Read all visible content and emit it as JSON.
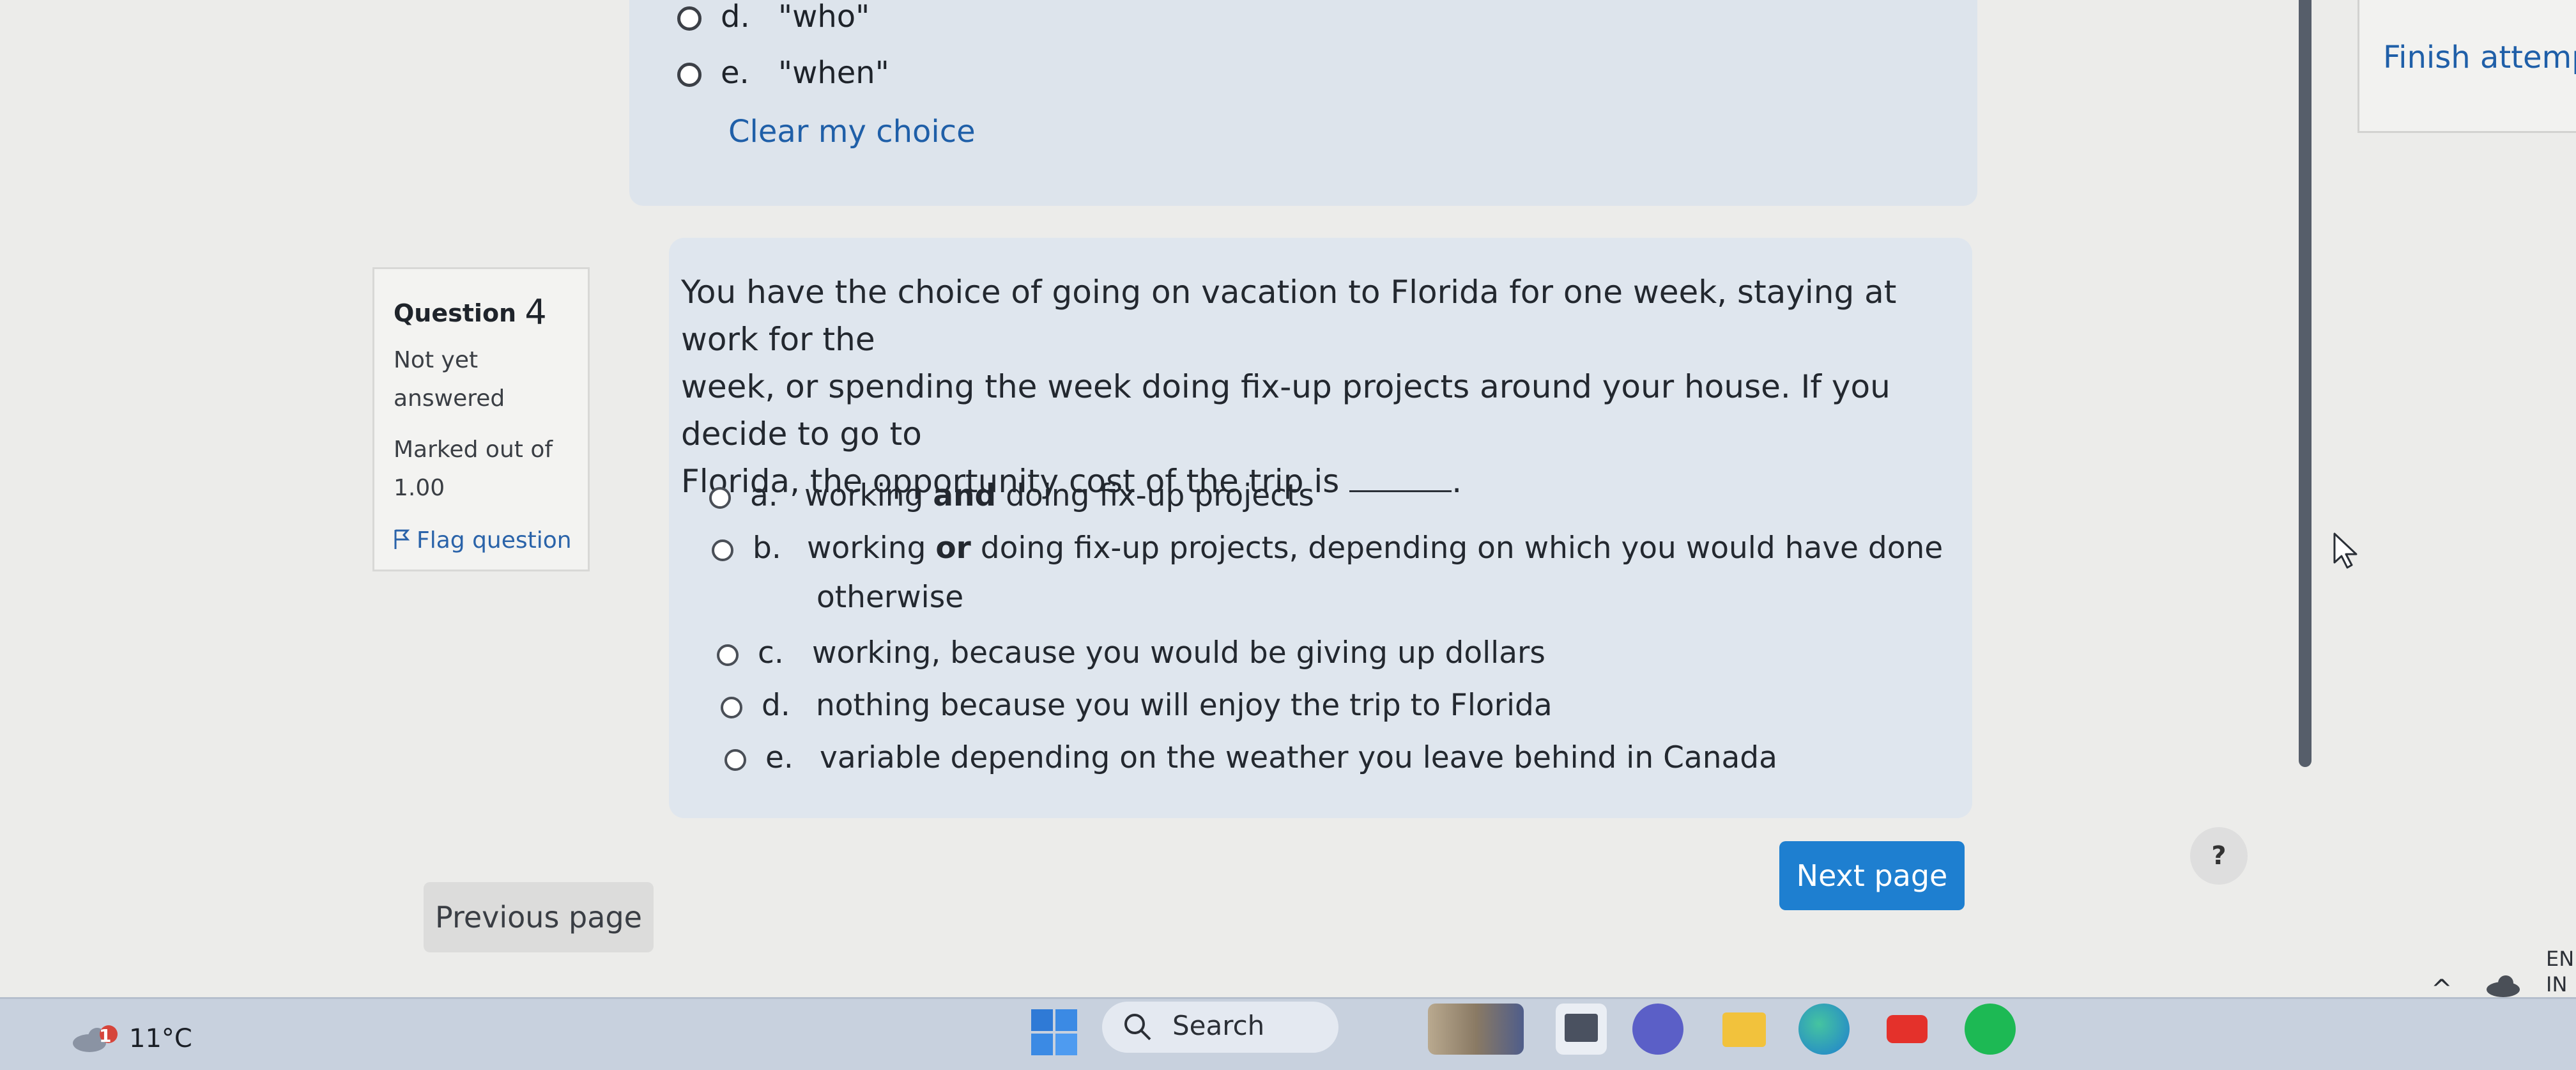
{
  "prev_question": {
    "options": [
      {
        "letter": "d.",
        "text": "\"who\""
      },
      {
        "letter": "e.",
        "text": "\"when\""
      }
    ],
    "clear_choice": "Clear my choice"
  },
  "question": {
    "label": "Question",
    "number": "4",
    "status": [
      "Not yet",
      "answered"
    ],
    "marks": [
      "Marked out of",
      "1.00"
    ],
    "flag": "Flag question",
    "text_lines": [
      "You have the choice of going on vacation to Florida for one week, staying at work for the",
      "week, or spending the week doing fix-up projects around your house. If you decide to go to",
      "Florida, the opportunity cost of the trip is"
    ],
    "text_end": ".",
    "options": [
      {
        "letter": "a.",
        "pre": "working ",
        "bold": "and",
        "post": " doing fix-up projects"
      },
      {
        "letter": "b.",
        "pre": "working ",
        "bold": "or",
        "post": " doing fix-up projects, depending on which you would have done",
        "cont": "otherwise"
      },
      {
        "letter": "c.",
        "text": "working, because you would be giving up dollars"
      },
      {
        "letter": "d.",
        "text": "nothing because you will enjoy the trip to Florida"
      },
      {
        "letter": "e.",
        "text": "variable depending on the weather you leave behind in Canada"
      }
    ]
  },
  "nav": {
    "previous": "Previous page",
    "next": "Next page",
    "help": "?"
  },
  "sidebar": {
    "finish": "Finish attempt"
  },
  "taskbar": {
    "weather_temp": "11°C",
    "weather_badge": "1",
    "search": "Search",
    "lang_lines": [
      "EN",
      "IN"
    ],
    "icons": [
      "windows-start-icon",
      "search-icon",
      "widgets-icon",
      "file-explorer-icon",
      "teams-icon",
      "folder-icon",
      "edge-icon",
      "youtube-icon",
      "spotify-icon"
    ]
  },
  "colors": {
    "accent_blue": "#1e7fd0",
    "link_blue": "#1f5fa8",
    "card_bg": "#dfe6ee"
  }
}
